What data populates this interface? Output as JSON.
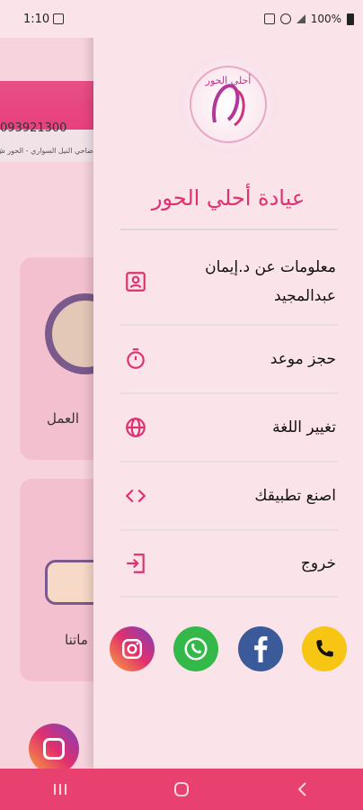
{
  "status_bar": {
    "time": "1:10",
    "battery": "100%"
  },
  "background": {
    "phone": "093921300",
    "address": "ضاحي النيل السواري - الحور ش",
    "card1_label": "العمل",
    "card2_label": "ماتنا"
  },
  "drawer": {
    "logo_text": "أحلي الحور",
    "title": "عيادة أحلي الحور",
    "menu": [
      {
        "label": "معلومات عن د.إيمان عبدالمجيد",
        "icon": "contact-card-icon"
      },
      {
        "label": "حجز موعد",
        "icon": "stopwatch-icon"
      },
      {
        "label": "تغيير اللغة",
        "icon": "globe-icon"
      },
      {
        "label": "اصنع تطبيقك",
        "icon": "code-icon"
      },
      {
        "label": "خروج",
        "icon": "logout-icon"
      }
    ],
    "contacts": [
      "phone-icon",
      "facebook-icon",
      "whatsapp-icon",
      "instagram-icon"
    ]
  },
  "colors": {
    "accent": "#e0306f",
    "drawer_bg": "#fbe3ea",
    "nav": "#e8406f"
  }
}
